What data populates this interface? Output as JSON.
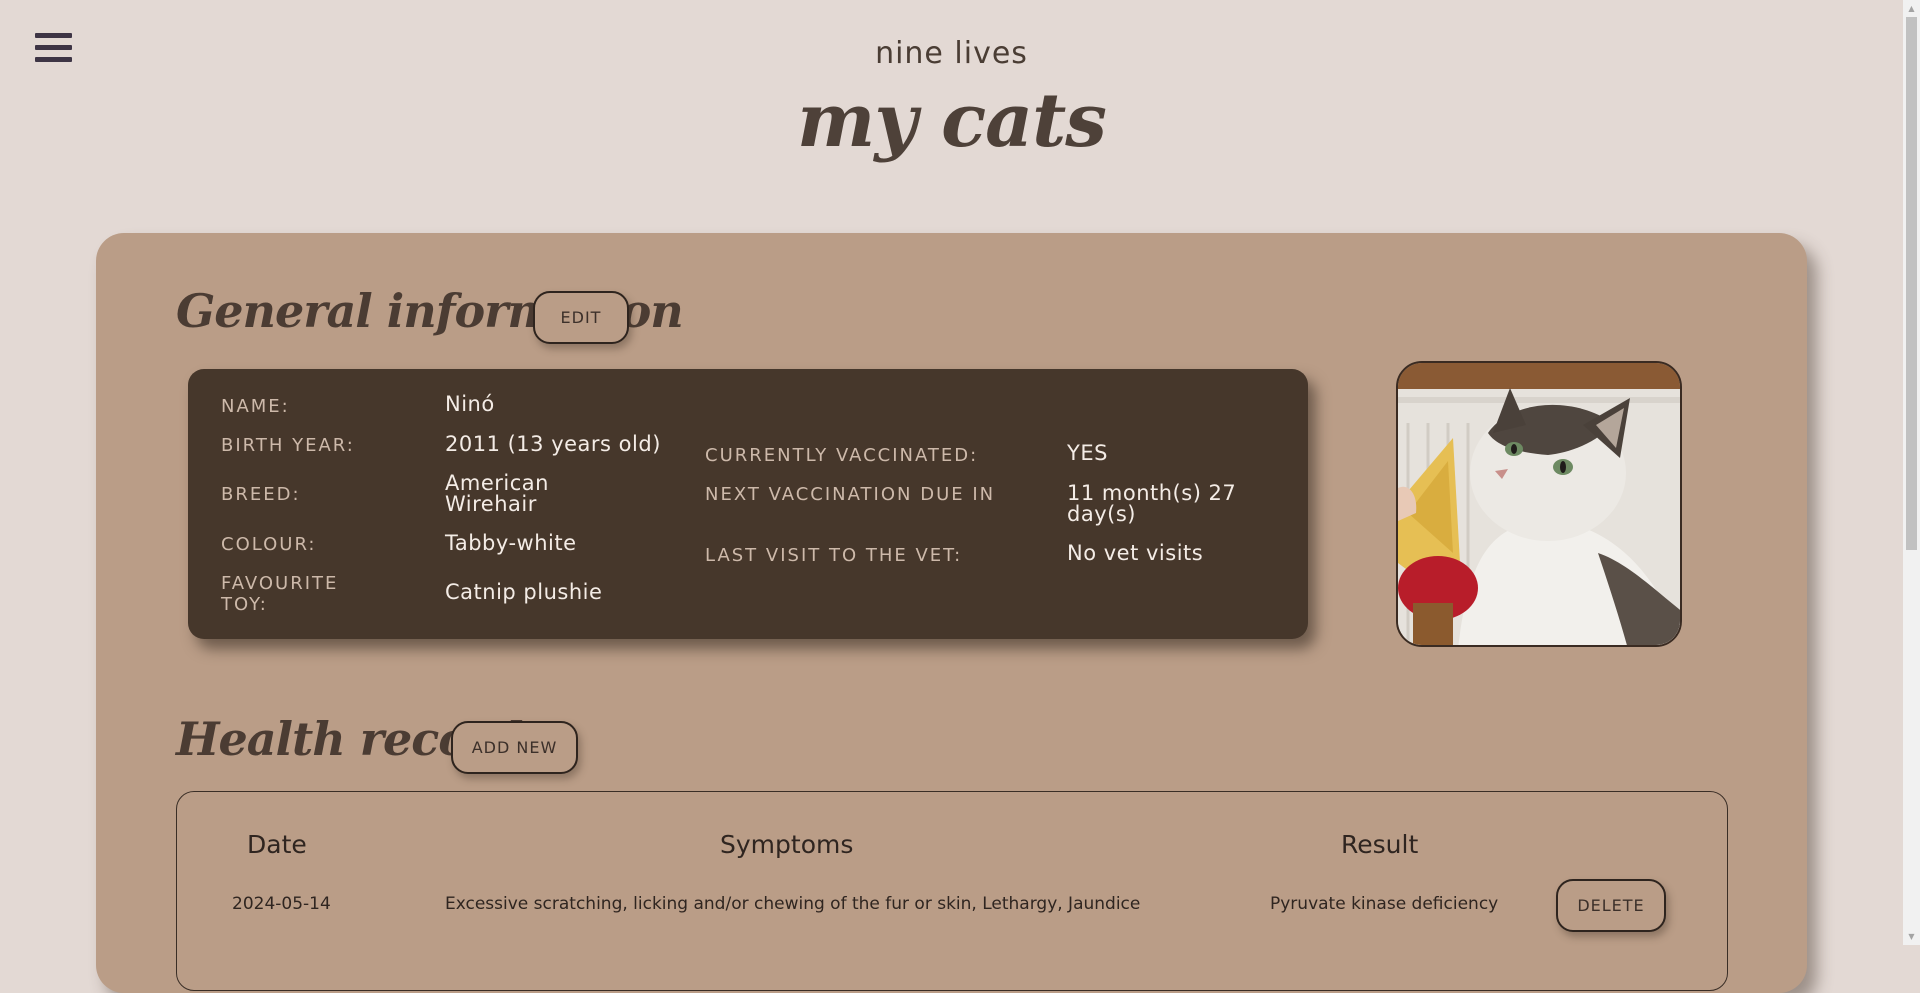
{
  "site": {
    "name": "nine lives"
  },
  "page": {
    "title": "my cats"
  },
  "general": {
    "heading": "General information",
    "edit_label": "EDIT",
    "fields": {
      "name_label": "NAME:",
      "name_value": "Ninó",
      "birth_label": "BIRTH YEAR:",
      "birth_value": "2011 (13 years old)",
      "breed_label": "BREED:",
      "breed_value": "American Wirehair",
      "colour_label": "COLOUR:",
      "colour_value": "Tabby-white",
      "toy_label": "FAVOURITE TOY:",
      "toy_value": "Catnip plushie",
      "vacc_label": "CURRENTLY VACCINATED:",
      "vacc_value": "YES",
      "next_vacc_label": "NEXT VACCINATION DUE IN",
      "next_vacc_value": "11 month(s) 27 day(s)",
      "last_visit_label": "LAST VISIT TO THE VET:",
      "last_visit_value": "No vet visits"
    }
  },
  "health": {
    "heading": "Health records",
    "add_label": "ADD NEW",
    "columns": {
      "date": "Date",
      "symptoms": "Symptoms",
      "result": "Result"
    },
    "rows": [
      {
        "date": "2024-05-14",
        "symptoms": "Excessive scratching, licking and/or chewing of the fur or skin, Lethargy, Jaundice",
        "result": "Pyruvate kinase deficiency",
        "delete_label": "DELETE"
      }
    ]
  },
  "icons": {
    "menu": "hamburger-menu-icon",
    "photo": "cat-photo"
  },
  "colors": {
    "background": "#e3d9d4",
    "card": "#ba9d87",
    "panel": "#46372b",
    "heading": "#4b3c33"
  }
}
